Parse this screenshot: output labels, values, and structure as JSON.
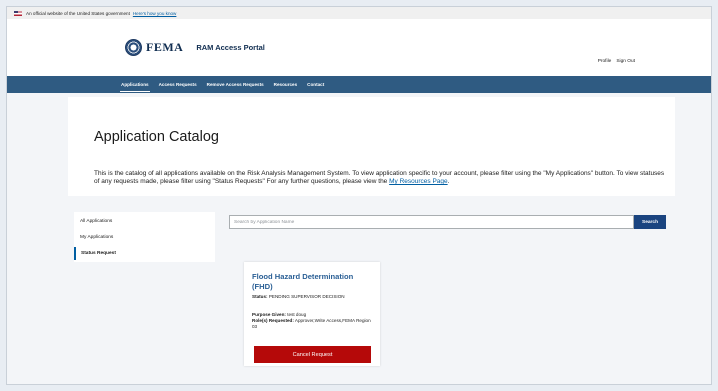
{
  "gov_banner": {
    "text": "An official website of the United States government",
    "link": "Here's how you know"
  },
  "header": {
    "agency": "FEMA",
    "portal_title": "RAM Access Portal",
    "user_links": [
      "Profile",
      "Sign Out"
    ]
  },
  "nav": {
    "items": [
      "Applications",
      "Access Requests",
      "Remove Access Requests",
      "Resources",
      "Contact"
    ],
    "active": "Applications"
  },
  "hero": {
    "title": "Application Catalog",
    "description": "This is the catalog of all applications available on the Risk Analysis Management System. To view application specific to your account, please filter using the \"My Applications\" button. To view statuses of any requests made, please filter using \"Status Requests\" For any further questions, please view the ",
    "link_text": "My Resources Page",
    "suffix": "."
  },
  "sidebar": {
    "items": [
      "All Applications",
      "My Applications",
      "Status Request"
    ],
    "active": "Status Request"
  },
  "search": {
    "placeholder": "Search by Application Name",
    "button_label": "Search"
  },
  "card": {
    "title": "Flood Hazard Determination (FHD)",
    "status_label": "Status:",
    "status_value": "PENDING SUPERVISOR DECISION",
    "purpose_label": "Purpose Given:",
    "purpose_value": "test doug",
    "roles_label": "Role(s) Requested:",
    "roles_value": "Approver,Write Access,FEMA Region 03",
    "cancel_label": "Cancel Request"
  },
  "colors": {
    "nav_bg": "#2f5b82",
    "link": "#005ea2",
    "search_button": "#1a4480",
    "cancel_button": "#b50909",
    "card_title": "#2a5f95"
  }
}
